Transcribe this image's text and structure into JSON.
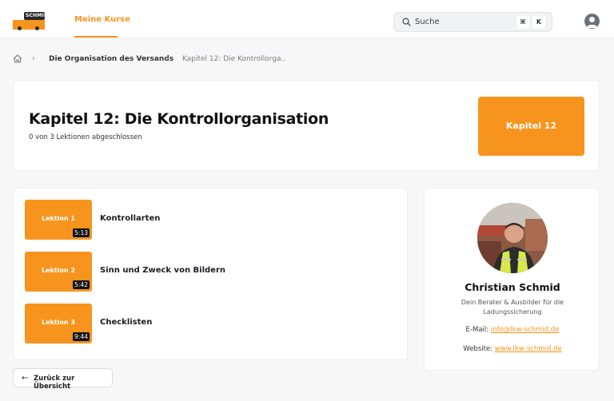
{
  "header": {
    "logo_text": "SCHMID",
    "nav_course": "Meine Kurse",
    "search": {
      "label": "Suche",
      "key1": "⌘",
      "key2": "K"
    }
  },
  "breadcrumb": {
    "link": "Die Organisation des Versands",
    "current": "Kapitel 12: Die Kontrollorga.."
  },
  "chapter": {
    "title": "Kapitel 12: Die Kontrollorganisation",
    "progress": "0 von 3 Lektionen abgeschlossen",
    "badge": "Kapitel 12"
  },
  "lessons": [
    {
      "thumb": "Lektion 1",
      "duration": "5:13",
      "title": "Kontrollarten"
    },
    {
      "thumb": "Lektion 2",
      "duration": "5:42",
      "title": "Sinn und Zweck von Bildern"
    },
    {
      "thumb": "Lektion 3",
      "duration": "9:44",
      "title": "Checklisten"
    }
  ],
  "instructor": {
    "name": "Christian Schmid",
    "role": "Dein Berater & Ausbilder für die Ladungssicherung",
    "email_label": "E-Mail:",
    "email": "info@lkw-schmid.de",
    "website_label": "Website:",
    "website": "www.lkw-schmid.de"
  },
  "back_button": {
    "label": "Zurück zur Übersicht"
  },
  "colors": {
    "accent": "#f6941d",
    "background": "#f7f7f8"
  }
}
